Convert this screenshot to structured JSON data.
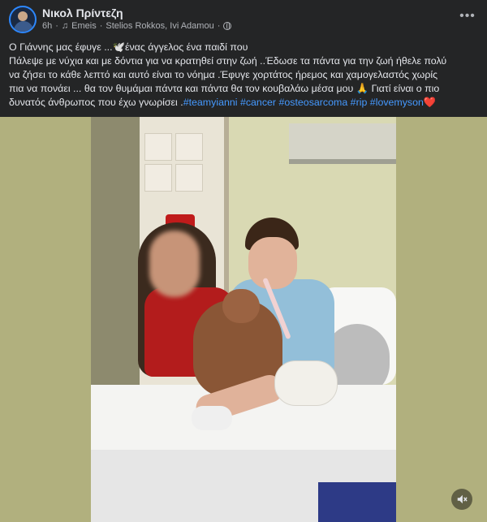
{
  "post": {
    "author": "Νικολ Πρίντεζη",
    "time": "6h",
    "separator": "·",
    "music_note": "♫",
    "audio": "Emeis",
    "tagged": "Stelios Rokkos, Ivi Adamou",
    "more_icon": "•••",
    "text": {
      "line1": "Ο Γιάννης μας έφυγε ...🕊️ένας άγγελος ένα παιδί που",
      "line2": "Πάλεψε με νύχια και με δόντια για να κρατηθεί στην ζωή ..Έδωσε τα πάντα για την ζωή ήθελε πολύ",
      "line3": "να ζήσει το κάθε λεπτό και αυτό είναι το νόημα .Έφυγε χορτάτος ήρεμος και χαμογελαστός χωρίς",
      "line4": "πια να πονάει ... θα τον θυμάμαι πάντα και πάντα θα τον κουβαλάω μέσα μου 🙏 Γιατί είναι ο πιο",
      "line5_prefix": "δυνατός άνθρωπος που έχω γνωρίσει .",
      "hashtags": [
        "#teamyianni",
        "#cancer",
        "#osteosarcoma",
        "#rip",
        "#lovemyson"
      ],
      "heart": "❤️"
    }
  },
  "colors": {
    "background": "#242526",
    "text": "#e4e6eb",
    "secondary_text": "#b0b3b8",
    "hashtag": "#4599ff",
    "photo_side_fill": "#b1b07e"
  },
  "icons": {
    "globe": "globe-icon",
    "more": "more-options-icon",
    "volume": "volume-muted-icon"
  }
}
